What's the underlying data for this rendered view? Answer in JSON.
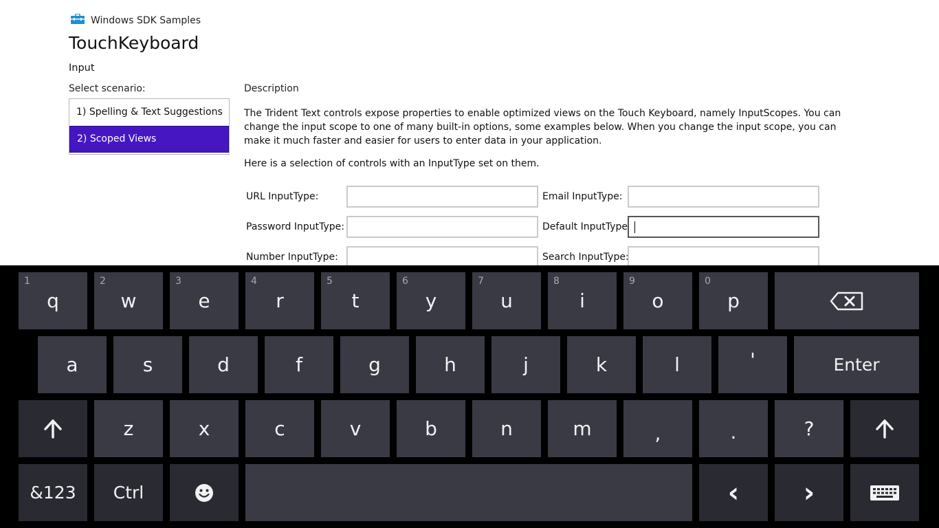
{
  "header": {
    "sdk_title": "Windows SDK Samples",
    "app_title": "TouchKeyboard",
    "category": "Input"
  },
  "sidebar": {
    "label": "Select scenario:",
    "items": [
      {
        "label": "1) Spelling & Text Suggestions",
        "selected": false
      },
      {
        "label": "2) Scoped Views",
        "selected": true
      }
    ],
    "accent": "#4616c2"
  },
  "main": {
    "description_label": "Description",
    "description": "The Trident Text controls expose properties to enable optimized views on the Touch Keyboard, namely InputScopes. You can change the input scope to one of many built-in options, some examples below. When you change the input scope, you can make it much faster and easier for users to enter data in your application.",
    "selection_text": "Here is a selection of controls with an InputType set on them.",
    "fields": {
      "url": {
        "label": "URL InputType:",
        "value": ""
      },
      "email": {
        "label": "Email InputType:",
        "value": ""
      },
      "password": {
        "label": "Password InputType:",
        "value": ""
      },
      "default": {
        "label": "Default InputType:",
        "value": "",
        "focused": true
      },
      "number": {
        "label": "Number InputType:",
        "value": ""
      },
      "search": {
        "label": "Search InputType:",
        "value": ""
      }
    }
  },
  "keyboard": {
    "row1": [
      {
        "key": "q",
        "num": "1"
      },
      {
        "key": "w",
        "num": "2"
      },
      {
        "key": "e",
        "num": "3"
      },
      {
        "key": "r",
        "num": "4"
      },
      {
        "key": "t",
        "num": "5"
      },
      {
        "key": "y",
        "num": "6"
      },
      {
        "key": "u",
        "num": "7"
      },
      {
        "key": "i",
        "num": "8"
      },
      {
        "key": "o",
        "num": "9"
      },
      {
        "key": "p",
        "num": "0"
      }
    ],
    "backspace_icon": "backspace-icon",
    "row2": [
      "a",
      "s",
      "d",
      "f",
      "g",
      "h",
      "j",
      "k",
      "l",
      "'"
    ],
    "enter": "Enter",
    "row3": [
      "z",
      "x",
      "c",
      "v",
      "b",
      "n",
      "m",
      ",",
      ".",
      "?"
    ],
    "shift_icon": "shift-arrow-icon",
    "symbols": "&123",
    "ctrl": "Ctrl",
    "emoji_icon": "smiley-icon",
    "left_arrow": "‹",
    "right_arrow": "›",
    "keyboard_icon": "keyboard-icon",
    "key_color": "#3a3a45",
    "background": "#000000"
  }
}
